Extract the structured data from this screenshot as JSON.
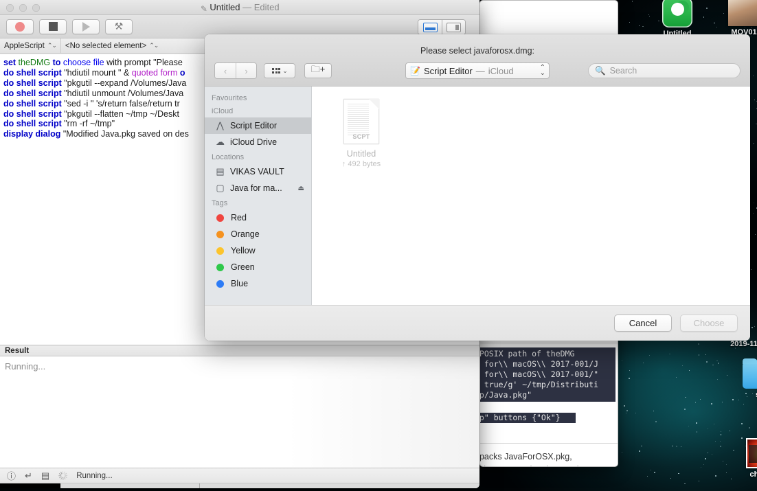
{
  "desktop": {
    "icons": [
      {
        "name": "Untitled",
        "type": "app-green"
      },
      {
        "name": "MOV01",
        "type": "mov-thumb"
      },
      {
        "name": "2019-11",
        "type": "text-only"
      },
      {
        "name": "sc",
        "type": "folder-blue"
      },
      {
        "name": "chopp",
        "type": "photo-thumb"
      }
    ]
  },
  "script_editor": {
    "title": {
      "document": "Untitled",
      "separator": "—",
      "state": "Edited"
    },
    "toolbar": {
      "record_label": "Record",
      "stop_label": "Stop",
      "run_label": "Run",
      "compile_label": "Compile",
      "view_standard_label": "Standard View",
      "view_split_label": "Split View"
    },
    "subbar": {
      "language": "AppleScript",
      "element": "<No selected element>"
    },
    "code_lines": [
      [
        {
          "t": "set ",
          "c": "kw"
        },
        {
          "t": "theDMG",
          "c": "var"
        },
        {
          "t": " to ",
          "c": "kw"
        },
        {
          "t": "choose file",
          "c": "kw2"
        },
        {
          "t": " with prompt ",
          "c": "plain"
        },
        {
          "t": "\"Please",
          "c": "str"
        }
      ],
      [
        {
          "t": "do shell script",
          "c": "kw"
        },
        {
          "t": " \"hdiutil mount \" & ",
          "c": "str"
        },
        {
          "t": "quoted form ",
          "c": "ref"
        },
        {
          "t": "o",
          "c": "kw"
        }
      ],
      [
        {
          "t": "do shell script",
          "c": "kw"
        },
        {
          "t": " \"pkgutil --expand /Volumes/Java",
          "c": "str"
        }
      ],
      [
        {
          "t": "do shell script",
          "c": "kw"
        },
        {
          "t": " \"hdiutil unmount /Volumes/Java",
          "c": "str"
        }
      ],
      [
        {
          "t": "do shell script",
          "c": "kw"
        },
        {
          "t": " \"sed -i '' 's/return false/return tr",
          "c": "str"
        }
      ],
      [
        {
          "t": "do shell script",
          "c": "kw"
        },
        {
          "t": " \"pkgutil --flatten ~/tmp ~/Deskt",
          "c": "str"
        }
      ],
      [
        {
          "t": "do shell script",
          "c": "kw"
        },
        {
          "t": " \"rm -rf ~/tmp\"",
          "c": "str"
        }
      ],
      [
        {
          "t": "display dialog",
          "c": "kw"
        },
        {
          "t": " \"Modified Java.pkg saved on des",
          "c": "str"
        }
      ]
    ],
    "result": {
      "header": "Result",
      "body": "Running..."
    },
    "status": {
      "info_icon": "info-icon",
      "return_icon": "return-icon",
      "list_icon": "list-icon",
      "spinner_icon": "progress-spinner-icon",
      "text": "Running..."
    }
  },
  "background_window": {
    "code_block_lines": [
      " POSIX path of theDMG",
      "\\ for\\\\ macOS\\\\ 2017-001/J",
      "  for\\\\ macOS\\\\ 2017-001/\"",
      "n true/g' ~/tmp/Distributi",
      "op/Java.pkg\""
    ],
    "code_block2": "op\" buttons {\"Ok\"}",
    "body_text": "npacks JavaForOSX.pkg,\nesktop, Java.pkg, that can be"
  },
  "file_dialog": {
    "prompt": "Please select javaforosx.dmg:",
    "nav": {
      "back_label": "‹",
      "forward_label": "›"
    },
    "view_button_label": "icon-view",
    "new_folder_label": "new-folder",
    "path_popup": {
      "icon": "script-editor-icon",
      "app": "Script Editor",
      "dash": "—",
      "location": "iCloud"
    },
    "search": {
      "placeholder": "Search",
      "value": ""
    },
    "sidebar": [
      {
        "kind": "header",
        "label": "Favourites"
      },
      {
        "kind": "header",
        "label": "iCloud"
      },
      {
        "kind": "item",
        "label": "Script Editor",
        "icon": "script-editor-icon",
        "selected": true
      },
      {
        "kind": "item",
        "label": "iCloud Drive",
        "icon": "cloud-icon",
        "selected": false
      },
      {
        "kind": "header",
        "label": "Locations"
      },
      {
        "kind": "item",
        "label": "VIKAS VAULT",
        "icon": "hard-drive-icon",
        "selected": false
      },
      {
        "kind": "item",
        "label": "Java for ma...",
        "icon": "disk-icon",
        "selected": false,
        "eject": "⏏"
      },
      {
        "kind": "header",
        "label": "Tags"
      },
      {
        "kind": "tag",
        "label": "Red",
        "color": "#f0453f"
      },
      {
        "kind": "tag",
        "label": "Orange",
        "color": "#f5921f"
      },
      {
        "kind": "tag",
        "label": "Yellow",
        "color": "#fcc42c"
      },
      {
        "kind": "tag",
        "label": "Green",
        "color": "#2ec84a"
      },
      {
        "kind": "tag",
        "label": "Blue",
        "color": "#2d7cf6"
      }
    ],
    "files": [
      {
        "name": "Untitled",
        "size": "↑ 492 bytes",
        "badge": "SCPT"
      }
    ],
    "buttons": {
      "cancel": "Cancel",
      "choose": "Choose",
      "choose_disabled": true
    }
  }
}
